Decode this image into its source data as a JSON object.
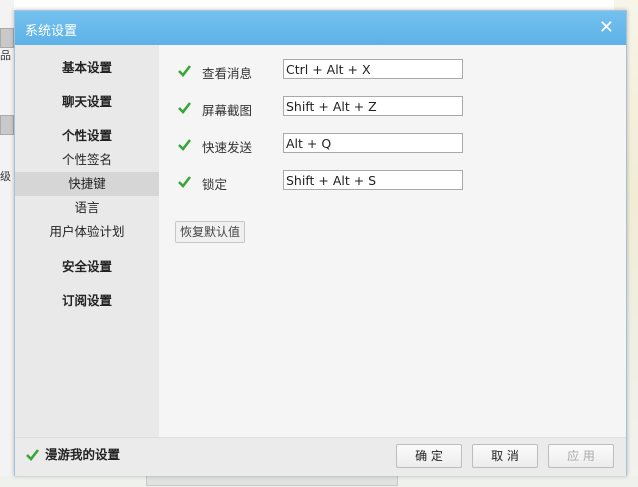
{
  "window": {
    "title": "系统设置"
  },
  "sidebar": {
    "items": [
      {
        "label": "基本设置"
      },
      {
        "label": "聊天设置"
      },
      {
        "label": "个性设置"
      },
      {
        "label": "个性签名"
      },
      {
        "label": "快捷键",
        "active": true
      },
      {
        "label": "语言"
      },
      {
        "label": "用户体验计划"
      },
      {
        "label": "安全设置"
      },
      {
        "label": "订阅设置"
      }
    ]
  },
  "shortcuts": [
    {
      "label": "查看消息",
      "value": "Ctrl + Alt + X",
      "checked": true
    },
    {
      "label": "屏幕截图",
      "value": "Shift + Alt + Z",
      "checked": true
    },
    {
      "label": "快速发送",
      "value": "Alt + Q",
      "checked": true
    },
    {
      "label": "锁定",
      "value": "Shift + Alt + S",
      "checked": true
    }
  ],
  "restore_label": "恢复默认值",
  "footer": {
    "roam_label": "漫游我的设置",
    "roam_checked": true,
    "ok_label": "确 定",
    "cancel_label": "取 消",
    "apply_label": "应 用"
  },
  "desktop": {
    "left_fragments": [
      "品",
      "级"
    ]
  },
  "colors": {
    "accent": "#5eb2e7",
    "check": "#3aa63a"
  }
}
